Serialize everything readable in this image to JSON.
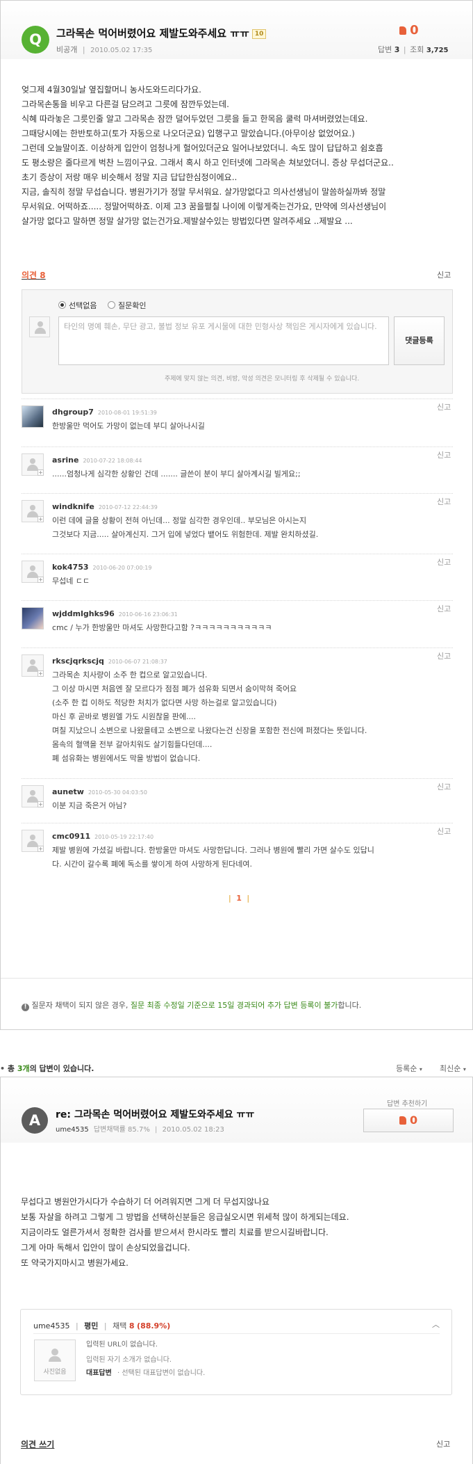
{
  "question": {
    "badge": "Q",
    "title": "그라목손 먹어버렸어요 제발도와주세요 ㅠㅠ",
    "points": "10",
    "visibility": "비공개",
    "date": "2010.05.02 17:35",
    "likes": "0",
    "answers_label": "답변",
    "answers_count": "3",
    "views_label": "조회",
    "views_count": "3,725",
    "body": [
      "엊그제 4월30일날 옆집할머니 농사도와드리다가요.",
      "그라목손통을 비우고 다른걸 담으려고 그릇에 잠깐두었는데.",
      "식혜 따라놓은 그릇인줄 알고 그라목손 잠깐 덜어두었던 그릇을 들고 한목음 쿨럭 마셔버렸었는데요.",
      "그때당시에는 한반토하고(토가 자동으로 나오더군요) 입행구고 말았습니다.(아무이상 없었어요.)",
      "그런데 오늘말이죠. 이상하게 입안이 엄청나게 헐어있더군요 일어나보았더니. 속도 많이 답답하고 쉼호흡",
      "도 평소량은 줄다르게 벅찬 느낌이구요. 그래서 혹시 하고 인터넷에 그라목손 쳐보았더니. 증상 무섭더군요..",
      "초기 증상이 저랑 매우 비슷해서 정말 지금 답답한심정이에요..",
      "지금, 솔직히 정말 무섭습니다. 병원가기가 정말 무서워요. 살가망없다고 의사선생님이 말씀하실까봐 정말",
      "무서워요. 어떡하죠..... 정말어떡하죠. 이제 고3 꿈을펼칠 나이에 이렇게죽는건가요, 만약에 의사선생님이",
      "살가망 없다고 말하면 정말 살가망 없는건가요.제발살수있는 방법있다면 알려주세요 ..제발요 ..."
    ]
  },
  "opinions": {
    "heading_prefix": "의견",
    "count": "8",
    "report": "신고",
    "radio_none": "선택없음",
    "radio_check": "질문확인",
    "placeholder": "타인의 명예 훼손, 무단 광고, 불법 정보 유포 게시물에 대한 민형사상 책임은 게시자에게 있습니다.",
    "submit": "댓글등록",
    "notice": "주제에 맞지 않는 의견, 비방, 악성 의견은 모니터링 후 삭제될 수 있습니다.",
    "items": [
      {
        "name": "dhgroup7",
        "date": "2010-08-01 19:51:39",
        "lines": [
          "한방울만 먹어도 가망이 없는데 부디 살아나시길"
        ]
      },
      {
        "name": "asrine",
        "date": "2010-07-22 18:08:44",
        "lines": [
          "......엄청나게 심각한 상황인 건데 .......  글쓴이 분이 부디 살아계시길 빌게요;;"
        ]
      },
      {
        "name": "windknife",
        "date": "2010-07-12 22:44:39",
        "lines": [
          "이런 데에 글을 상황이 전혀 아닌데... 정말 심각한 경우인데.. 부모님은 아시는지",
          "그것보다 지금..... 살아계신지. 그거 입에 넣었다 뱉어도 위험한데. 제발 완치하셨길."
        ]
      },
      {
        "name": "kok4753",
        "date": "2010-06-20 07:00:19",
        "lines": [
          "무섭네 ㄷㄷ"
        ]
      },
      {
        "name": "wjddmlghks96",
        "date": "2010-06-16 23:06:31",
        "lines": [
          "cmc / 누가 한방울만 마셔도 사망한다고함 ?ㅋㅋㅋㅋㅋㅋㅋㅋㅋㅋㅋ"
        ]
      },
      {
        "name": "rkscjqrkscjq",
        "date": "2010-06-07 21:08:37",
        "lines": [
          "그라목손 치사량이 소주 한 컵으로 알고있습니다.",
          "그 이상 마시면 처음엔 잘 모르다가 점점 폐가 섬유화 되면서 숨이막혀 죽어요",
          "(소주 한 컵 이하도 적당한 처치가 없다면 사망 하는걸로 알고있습니다)",
          "마신 후 곧바로 병원엘 가도 시원찮을 판에....",
          "며칠 지났으니 소변으로 나왔을테고 소변으로 나왔다는건 신장을 포함한 전신에 퍼졌다는 뜻입니다.",
          "몸속의 혈액을 전부 갈아치워도 살기힘들다던데....",
          "폐 섬유화는 병원에서도 막을 방법이 없습니다."
        ]
      },
      {
        "name": "aunetw",
        "date": "2010-05-30 04:03:50",
        "lines": [
          "이분 지금 죽은거 아님?"
        ]
      },
      {
        "name": "cmc0911",
        "date": "2010-05-19 22:17:40",
        "lines": [
          "제발 병원에 가셨길 바랍니다. 한방울만 마셔도 사망한답니다. 그러나 병원에 빨리 가면 살수도 있답니",
          "다. 시간이 갈수록 폐에 독소를 쌓이게 하여 사망하게 된다네여."
        ]
      }
    ],
    "page": "1"
  },
  "footer_notice": {
    "pre": "질문자 채택이 되지 않은 경우, ",
    "highlight": "질문 최종 수정일 기준으로 15일 경과되어 추가 답변 등록이 불가",
    "post": "합니다."
  },
  "answers_bar": {
    "pre": "총 ",
    "count": "3개",
    "post": "의 답변이 있습니다.",
    "sort1": "등록순",
    "sort2": "최신순"
  },
  "answer": {
    "badge": "A",
    "title": "re: 그라목손 먹어버렸어요 제발도와주세요 ㅠㅠ",
    "user": "ume4535",
    "rate": "답변채택률 85.7%",
    "date": "2010.05.02 18:23",
    "recommend_label": "답변 추천하기",
    "likes": "0",
    "body": [
      "무섭다고 병원안가시다가 수습하기 더 어려워지면 그게 더 무섭지않나요",
      "보통 자살을 하려고 그렇게 그 방법을 선택하신분들은 응급실오시면 위세척 많이 하게되는데요.",
      "지금이라도 얼른가셔서 정확한 검사를 받으셔서 한시라도 빨리 치료를 받으시길바랍니다.",
      "그게 아마 독해서 입안이 많이 손상되었을겁니다.",
      "또 약국가지마시고 병원가세요."
    ],
    "profile": {
      "user": "ume4535",
      "grade": "평민",
      "adopt_label": "채택",
      "adopt_count": "8",
      "adopt_rate": "(88.9%)",
      "photo_label": "사진없음",
      "url_line": "입력된 URL이 없습니다.",
      "intro_line": "입력된 자기 소개가 없습니다.",
      "rep_label": "대표답변",
      "rep_line": "· 선택된 대표답변이 없습니다."
    },
    "opinion_write": "의견 쓰기",
    "report": "신고"
  },
  "colors": {
    "accent_green": "#57b233",
    "accent_orange": "#e8613a",
    "notice_green": "#3a8a1a"
  }
}
